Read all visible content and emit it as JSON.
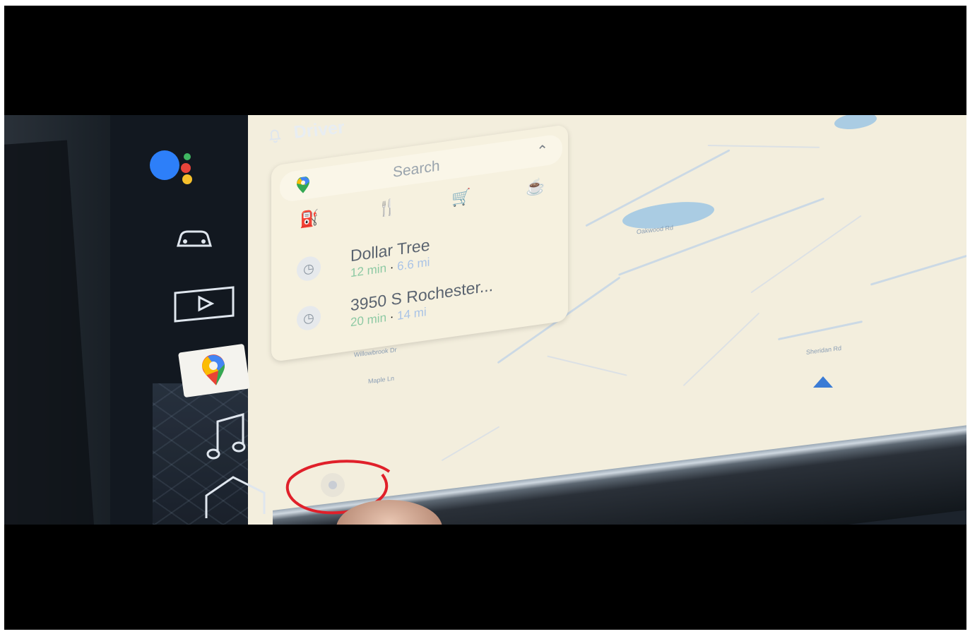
{
  "header": {
    "profile_label": "Driver"
  },
  "sidebar": {
    "items": [
      {
        "name": "assistant-icon"
      },
      {
        "name": "car-icon"
      },
      {
        "name": "play-icon"
      },
      {
        "name": "maps-icon"
      },
      {
        "name": "music-icon"
      },
      {
        "name": "home-icon"
      }
    ]
  },
  "search": {
    "placeholder": "Search"
  },
  "categories": [
    {
      "icon": "gas-station-icon"
    },
    {
      "icon": "restaurant-icon"
    },
    {
      "icon": "shopping-cart-icon"
    },
    {
      "icon": "coffee-icon"
    }
  ],
  "recent": [
    {
      "title": "Dollar Tree",
      "eta": "12 min",
      "distance": "6.6 mi"
    },
    {
      "title": "3950 S Rochester...",
      "eta": "20 min",
      "distance": "14 mi"
    }
  ],
  "colors": {
    "accent_red": "#c6263a",
    "eta_green": "#8cc9a3",
    "map_bg": "#f3eedd",
    "water": "#9cc6e4",
    "nav_arrow": "#3a7bd5"
  }
}
